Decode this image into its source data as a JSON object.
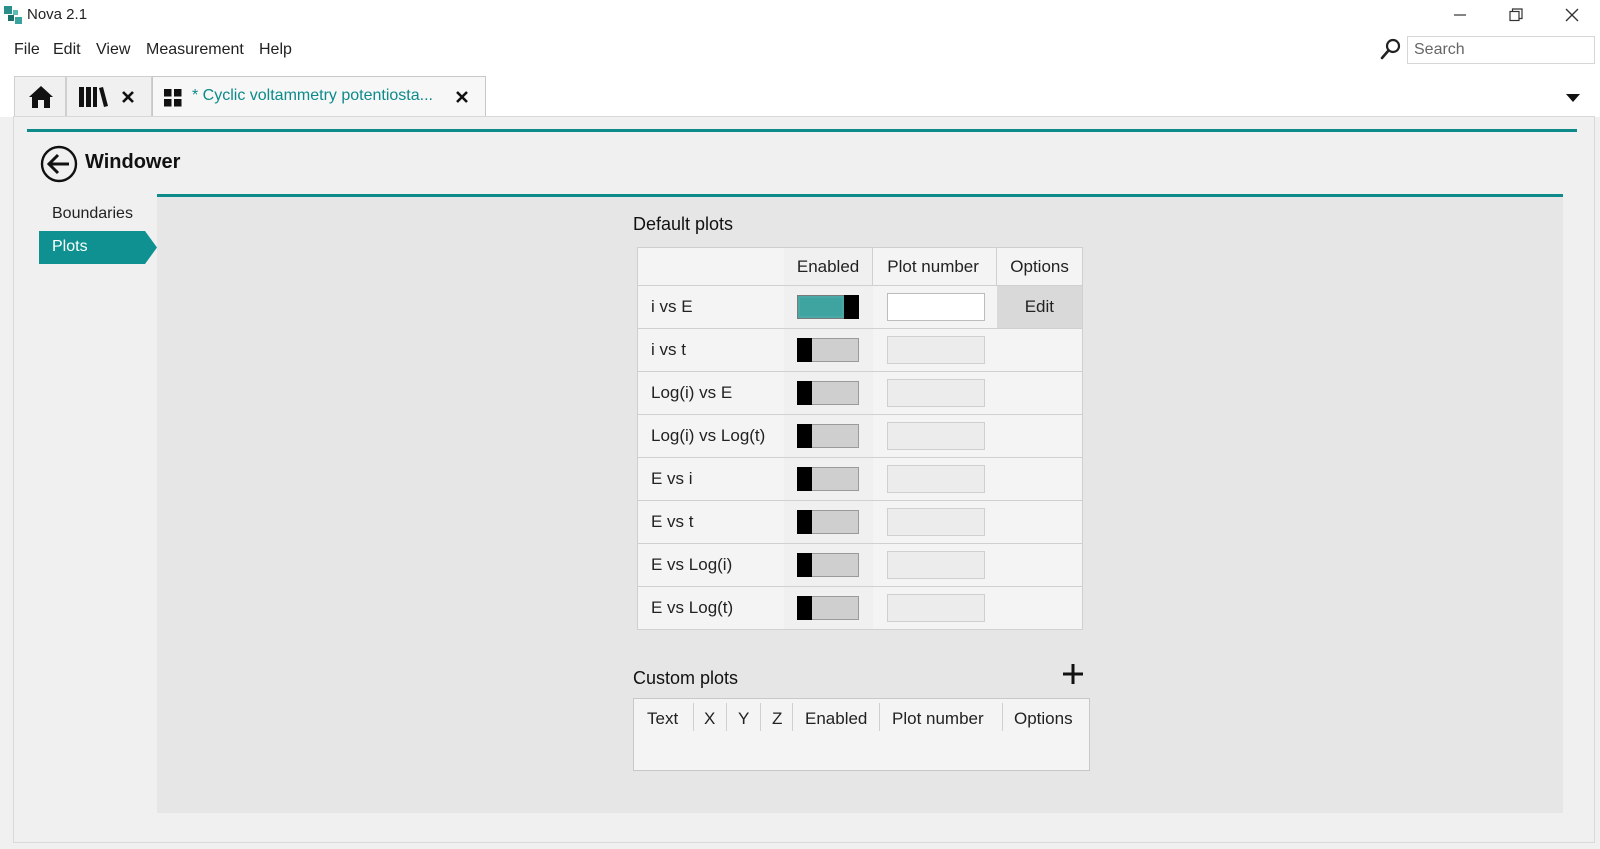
{
  "window": {
    "title": "Nova 2.1",
    "controls": [
      "minimize",
      "restore",
      "close"
    ]
  },
  "menu": {
    "items": [
      "File",
      "Edit",
      "View",
      "Measurement",
      "Help"
    ]
  },
  "search": {
    "placeholder": "Search"
  },
  "tabs": {
    "active_label": "* Cyclic voltammetry potentiosta..."
  },
  "page": {
    "title": "Windower"
  },
  "nav": {
    "items": [
      {
        "label": "Boundaries",
        "active": false
      },
      {
        "label": "Plots",
        "active": true
      }
    ]
  },
  "default_plots": {
    "title": "Default plots",
    "headers": {
      "enabled": "Enabled",
      "plot_number": "Plot number",
      "options": "Options"
    },
    "rows": [
      {
        "name": "i vs E",
        "enabled": true,
        "plot_number": "",
        "option": "Edit"
      },
      {
        "name": "i vs t",
        "enabled": false,
        "plot_number": "",
        "option": ""
      },
      {
        "name": "Log(i) vs E",
        "enabled": false,
        "plot_number": "",
        "option": ""
      },
      {
        "name": "Log(i) vs Log(t)",
        "enabled": false,
        "plot_number": "",
        "option": ""
      },
      {
        "name": "E vs i",
        "enabled": false,
        "plot_number": "",
        "option": ""
      },
      {
        "name": "E vs t",
        "enabled": false,
        "plot_number": "",
        "option": ""
      },
      {
        "name": "E vs Log(i)",
        "enabled": false,
        "plot_number": "",
        "option": ""
      },
      {
        "name": "E vs Log(t)",
        "enabled": false,
        "plot_number": "",
        "option": ""
      }
    ]
  },
  "custom_plots": {
    "title": "Custom plots",
    "headers": [
      "Text",
      "X",
      "Y",
      "Z",
      "Enabled",
      "Plot number",
      "Options"
    ]
  },
  "colors": {
    "accent": "#0e8a8a",
    "toggle_on": "#3fa39f"
  }
}
